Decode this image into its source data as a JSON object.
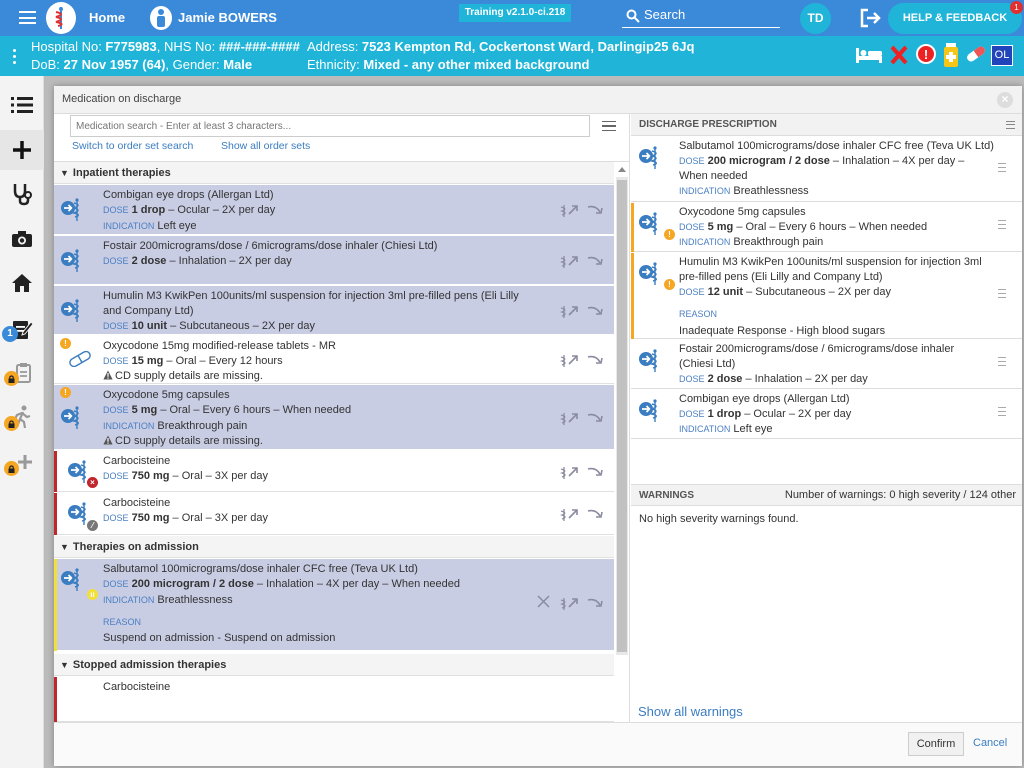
{
  "topbar": {
    "home": "Home",
    "patient": "Jamie BOWERS",
    "version": "Training v2.1.0-ci.218",
    "search": "Search",
    "avatar": "TD",
    "help": "HELP & FEEDBACK",
    "help_count": "1"
  },
  "banner": {
    "hosp_label": "Hospital No: ",
    "hosp_no": "F775983",
    "nhs_label": ", NHS No: ",
    "nhs_no": "###-###-####",
    "addr_label": "Address: ",
    "address": "7523 Kempton Rd, Cockertonst Ward, Darlingip25 6Jq",
    "dob_label": "DoB: ",
    "dob": "27 Nov 1957 (64)",
    "gender_label": ", Gender: ",
    "gender": "Male",
    "eth_label": "Ethnicity: ",
    "ethnicity": "Mixed - any other mixed background",
    "ol": "OL"
  },
  "nav": {
    "badge": "1"
  },
  "modal": {
    "title": "Medication on discharge",
    "search_placeholder": "Medication search - Enter at least 3 characters...",
    "link_order_set": "Switch to order set search",
    "link_show_all": "Show all order sets",
    "confirm": "Confirm",
    "cancel": "Cancel"
  },
  "labels": {
    "dose": "DOSE",
    "indication": "INDICATION",
    "reason": "REASON"
  },
  "left": {
    "sections": [
      "Inpatient therapies",
      "Therapies on admission",
      "Stopped admission therapies"
    ],
    "inpatient": [
      {
        "name": "Combigan eye drops (Allergan Ltd)",
        "dose": "1 drop",
        "rest": " – Ocular – 2X per day",
        "indication": "Left eye"
      },
      {
        "name": "Fostair 200micrograms/dose / 6micrograms/dose inhaler (Chiesi Ltd)",
        "dose": "2 dose",
        "rest": " – Inhalation – 2X per day"
      },
      {
        "name": "Humulin M3 KwikPen 100units/ml suspension for injection 3ml pre-filled pens (Eli Lilly and Company Ltd)",
        "dose": "10 unit",
        "rest": " – Subcutaneous – 2X per day"
      },
      {
        "name": "Oxycodone 15mg modified-release tablets - MR",
        "dose": "15 mg",
        "rest": " – Oral – Every 12 hours",
        "warning": "CD supply details are missing."
      },
      {
        "name": "Oxycodone 5mg capsules",
        "dose": "5 mg",
        "rest": " – Oral – Every 6 hours – When needed",
        "indication": "Breakthrough pain",
        "warning": "CD supply details are missing."
      },
      {
        "name": "Carbocisteine",
        "dose": "750 mg",
        "rest": " – Oral – 3X per day"
      },
      {
        "name": "Carbocisteine",
        "dose": "750 mg",
        "rest": " – Oral – 3X per day"
      }
    ],
    "admission": [
      {
        "name": "Salbutamol 100micrograms/dose inhaler CFC free (Teva UK Ltd)",
        "dose": "200 microgram / 2 dose",
        "rest": " – Inhalation – 4X per day – When needed",
        "indication": "Breathlessness",
        "reason": "Suspend on admission - Suspend on admission"
      }
    ],
    "stopped": [
      {
        "name": "Carbocisteine"
      }
    ]
  },
  "right": {
    "header": "DISCHARGE PRESCRIPTION",
    "items": [
      {
        "name": "Salbutamol 100micrograms/dose inhaler CFC free (Teva UK Ltd)",
        "dose": "200 microgram / 2 dose",
        "rest": " – Inhalation – 4X per day –",
        "rest2": "When needed",
        "indication": "Breathlessness"
      },
      {
        "name": "Oxycodone 5mg capsules",
        "dose": "5 mg",
        "rest": " – Oral – Every 6 hours – When needed",
        "indication": "Breakthrough pain"
      },
      {
        "name": "Humulin M3 KwikPen 100units/ml suspension for injection 3ml",
        "name2": "pre-filled pens (Eli Lilly and Company Ltd)",
        "dose": "12 unit",
        "rest": " – Subcutaneous – 2X per day",
        "reason": "Inadequate Response - High blood sugars"
      },
      {
        "name": "Fostair 200micrograms/dose / 6micrograms/dose inhaler",
        "name2": "(Chiesi Ltd)",
        "dose": "2 dose",
        "rest": " – Inhalation – 2X per day"
      },
      {
        "name": "Combigan eye drops (Allergan Ltd)",
        "dose": "1 drop",
        "rest": " – Ocular – 2X per day",
        "indication": "Left eye"
      }
    ],
    "warnings_header": "WARNINGS",
    "warnings_count": "Number of warnings: 0 high severity / 124 other",
    "warnings_text": "No high severity warnings found.",
    "show_all": "Show all warnings"
  }
}
